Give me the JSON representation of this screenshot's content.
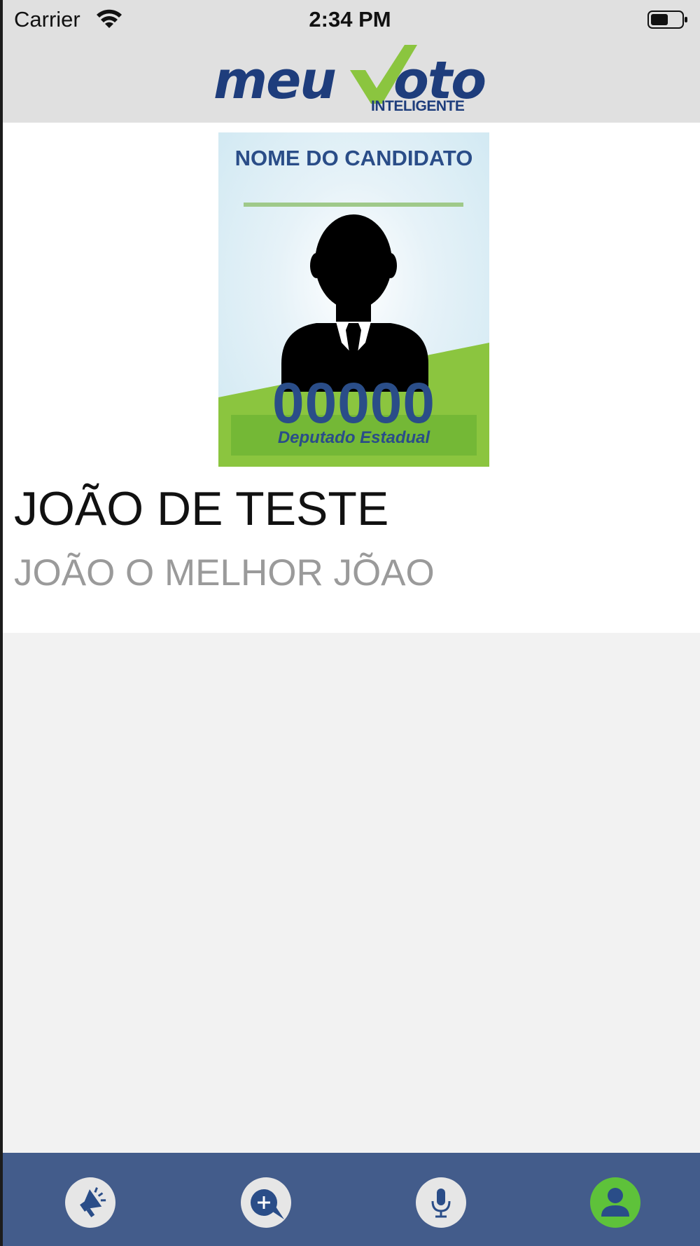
{
  "status_bar": {
    "carrier": "Carrier",
    "time": "2:34 PM"
  },
  "header": {
    "logo_word_1": "meu",
    "logo_word_2": "oto",
    "logo_subtitle": "INTELIGENTE"
  },
  "poster": {
    "title": "NOME DO CANDIDATO",
    "number": "00000",
    "role": "Deputado Estadual"
  },
  "candidate": {
    "name": "JOÃO DE TESTE",
    "slogan": "JOÃO O MELHOR JÕAO"
  },
  "tab_bar": {
    "tabs": [
      {
        "icon": "megaphone-icon",
        "selected": false
      },
      {
        "icon": "chat-add-icon",
        "selected": false
      },
      {
        "icon": "microphone-icon",
        "selected": false
      },
      {
        "icon": "profile-icon",
        "selected": true
      }
    ]
  },
  "colors": {
    "brand_blue": "#1e3d7c",
    "brand_green": "#8bc53f",
    "tab_bar": "#435c8b",
    "tab_selected": "#5ec23a"
  }
}
